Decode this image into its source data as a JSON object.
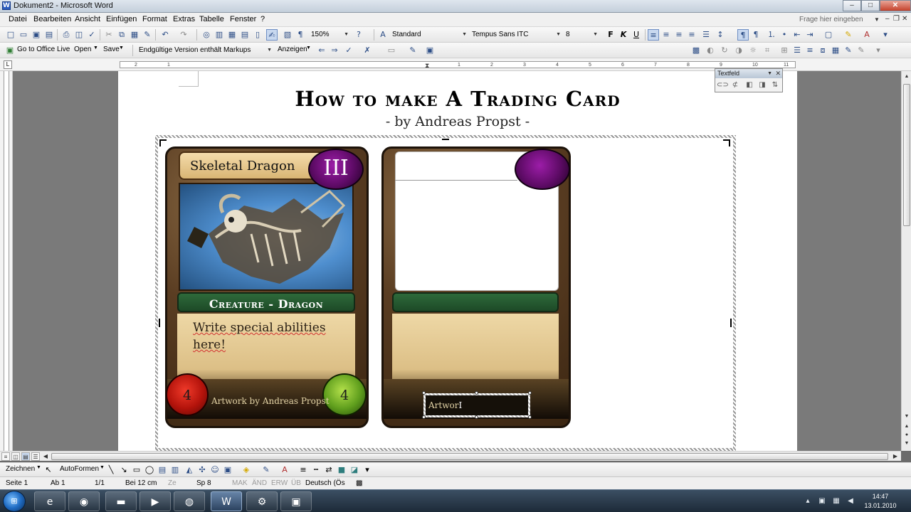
{
  "window": {
    "title": "Dokument2 - Microsoft Word",
    "buttons": {
      "minimize": "–",
      "maximize": "□",
      "close": "✕"
    }
  },
  "menubar": {
    "items": [
      "Datei",
      "Bearbeiten",
      "Ansicht",
      "Einfügen",
      "Format",
      "Extras",
      "Tabelle",
      "Fenster",
      "?"
    ],
    "help_placeholder": "Frage hier eingeben"
  },
  "standard_toolbar": {
    "zoom": "150%",
    "style": "Standard",
    "font": "Tempus Sans ITC",
    "font_size": "8",
    "bold": "F",
    "italic": "K",
    "underline": "U"
  },
  "reviewing_toolbar": {
    "office_live": "Go to Office Live",
    "open": "Open",
    "save": "Save",
    "markup_view": "Endgültige Version enthält Markups",
    "show": "Anzeigen"
  },
  "ruler": {
    "numbers": [
      "2",
      "1",
      "1",
      "2",
      "3",
      "4",
      "5",
      "6",
      "7",
      "8",
      "9",
      "10",
      "11"
    ]
  },
  "document": {
    "title": "How to make A Trading Card",
    "subtitle": "- by Andreas Propst -"
  },
  "card_front": {
    "name": "Skeletal Dragon",
    "cost": "III",
    "type": "Creature - Dragon",
    "ability_text": "Write special abilities here!",
    "attack": "4",
    "defense": "4",
    "artist": "Artwork by Andreas Propst"
  },
  "card_back": {
    "artist_partial": "Artwor",
    "cursor": "I"
  },
  "textfeld_toolbar": {
    "title": "Textfeld"
  },
  "drawing_toolbar": {
    "draw": "Zeichnen",
    "autoshapes": "AutoFormen"
  },
  "statusbar": {
    "page": "Seite 1",
    "section": "Ab 1",
    "page_count": "1/1",
    "at": "Bei 12 cm",
    "line": "Ze",
    "column": "Sp 8",
    "mak": "MAK",
    "and": "ÄND",
    "erw": "ERW",
    "ub": "ÜB",
    "language": "Deutsch (Ös"
  },
  "taskbar": {
    "time": "14:47",
    "date": "13.01.2010"
  },
  "colors": {
    "gem_purple": "#5e0b66",
    "type_green": "#2e6a3a",
    "attack_red": "#b3130b",
    "defense_green": "#5f9e1d"
  }
}
